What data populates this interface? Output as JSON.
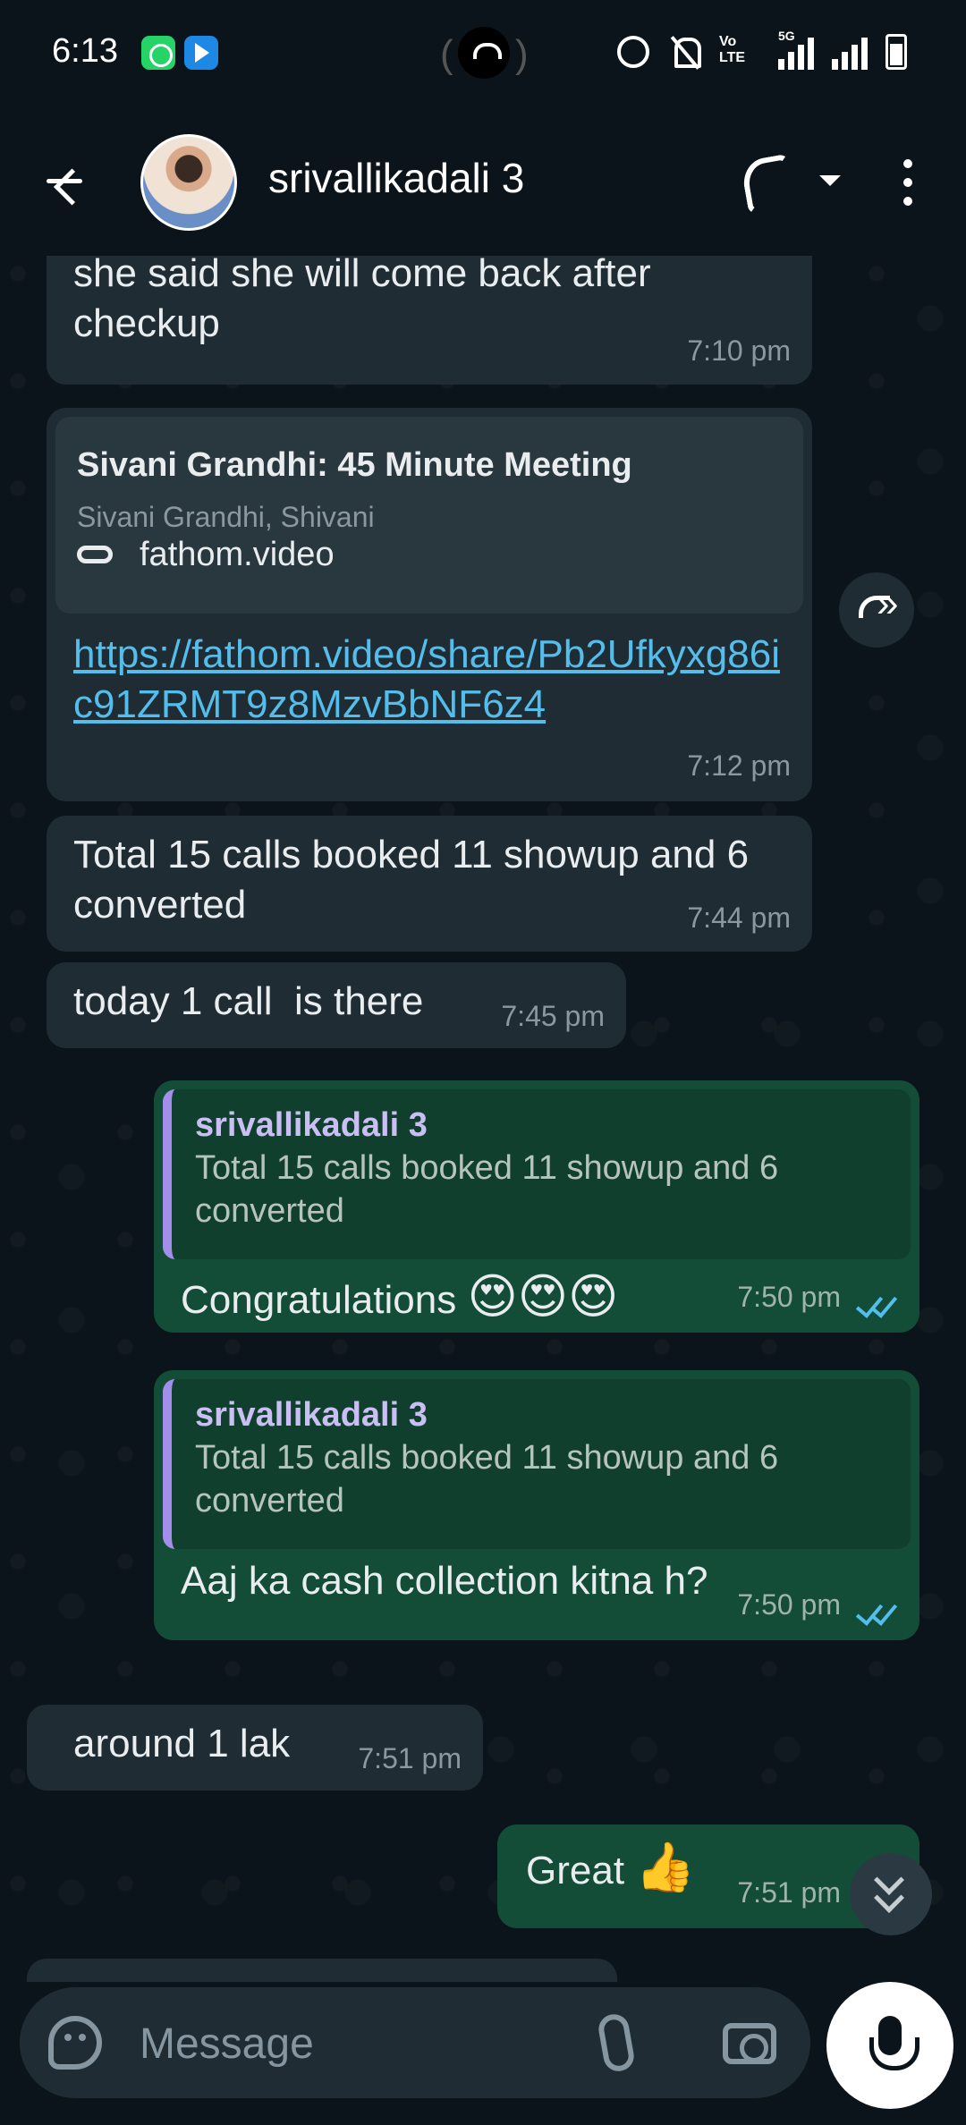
{
  "status_bar": {
    "time": "6:13",
    "network_label": "5G",
    "volte_label": "Vo LTE"
  },
  "header": {
    "contact_name": "srivallikadali 3"
  },
  "messages": [
    {
      "type": "in",
      "text": "she said she will come back after checkup",
      "time": "7:10 pm"
    },
    {
      "type": "in",
      "preview_title": "Sivani Grandhi: 45 Minute Meeting",
      "preview_subtitle": "Sivani Grandhi, Shivani",
      "preview_domain": "fathom.video",
      "link": "https://fathom.video/share/Pb2Ufkyxg86ic91ZRMT9z8MzvBbNF6z4",
      "time": "7:12 pm"
    },
    {
      "type": "in",
      "text": "Total 15 calls booked 11 showup and 6 converted",
      "time": "7:44 pm"
    },
    {
      "type": "in",
      "text": "today 1 call  is there",
      "time": "7:45 pm"
    },
    {
      "type": "out",
      "quote_name": "srivallikadali 3",
      "quote_text": "Total 15 calls booked 11 showup and 6 converted",
      "text": "Congratulations",
      "emoji": "😍😍😍",
      "time": "7:50 pm"
    },
    {
      "type": "out",
      "quote_name": "srivallikadali 3",
      "quote_text": "Total 15 calls booked 11 showup and 6 converted",
      "text": "Aaj ka cash collection kitna h?",
      "time": "7:50 pm"
    },
    {
      "type": "in",
      "text": "around 1 lak",
      "time": "7:51 pm"
    },
    {
      "type": "out",
      "text": "Great",
      "emoji": "👍",
      "time": "7:51 pm"
    }
  ],
  "input": {
    "placeholder": "Message"
  },
  "icons": {
    "back": "back-arrow-icon",
    "call": "phone-icon",
    "menu": "more-vert-icon",
    "forward": "forward-icon",
    "scroll_down": "double-chevron-down-icon",
    "sticker": "sticker-icon",
    "attach": "paperclip-icon",
    "camera": "camera-icon",
    "mic": "mic-icon"
  },
  "colors": {
    "background": "#0b141a",
    "incoming_bubble": "#1f2c34",
    "outgoing_bubble": "#144d37",
    "link": "#53bdeb",
    "read_ticks": "#53bdeb"
  }
}
